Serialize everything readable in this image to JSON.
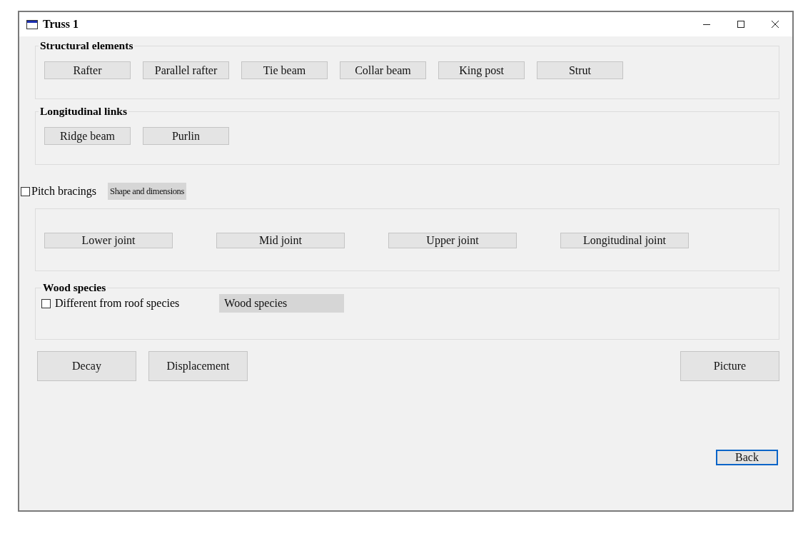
{
  "window": {
    "title": "Truss 1"
  },
  "structural_elements": {
    "label": "Structural elements",
    "buttons": [
      "Rafter",
      "Parallel rafter",
      "Tie beam",
      "Collar beam",
      "King post",
      "Strut"
    ]
  },
  "longitudinal_links": {
    "label": "Longitudinal links",
    "buttons": [
      "Ridge beam",
      "Purlin"
    ]
  },
  "pitch_bracings": {
    "label": "Pitch bracings",
    "checked": false
  },
  "shape_button": "Shape and dimensions",
  "joints": {
    "buttons": [
      "Lower joint",
      "Mid joint",
      "Upper joint",
      "Longitudinal joint"
    ]
  },
  "wood_species": {
    "label": "Wood species",
    "checkbox": {
      "label": "Different from roof species",
      "checked": false
    },
    "button": "Wood species"
  },
  "actions": [
    {
      "label": "Decay"
    },
    {
      "label": "Displacement"
    }
  ],
  "picture_button": "Picture",
  "back_button": {
    "label": "Back",
    "focused": true
  }
}
